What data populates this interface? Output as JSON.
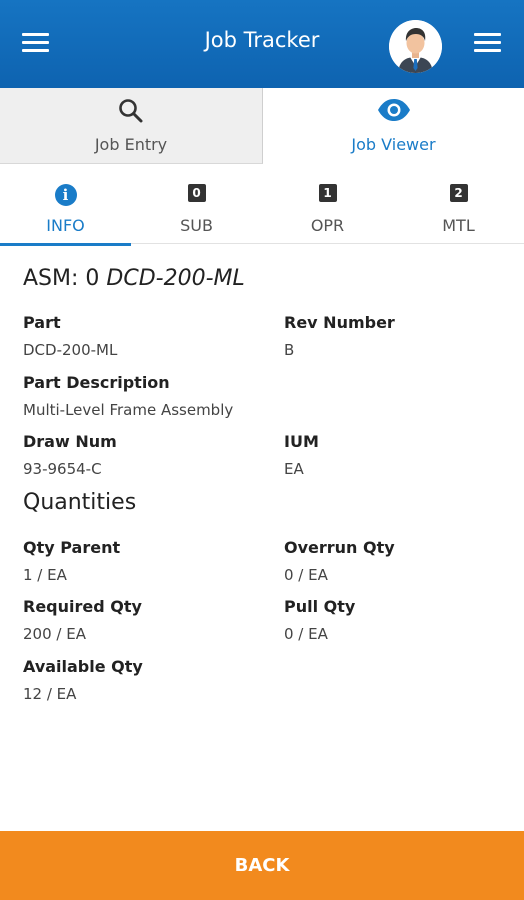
{
  "header": {
    "title": "Job Tracker",
    "menu_icon_left": "hamburger-menu-icon",
    "menu_icon_right": "hamburger-menu-icon",
    "avatar_icon": "user-avatar-icon",
    "colors": {
      "header_bg": "#1674c2",
      "accent": "#1a7cc8",
      "back": "#f28a1e"
    }
  },
  "main_tabs": [
    {
      "label": "Job Entry",
      "icon": "search-icon",
      "active": false
    },
    {
      "label": "Job Viewer",
      "icon": "eye-icon",
      "active": true
    }
  ],
  "sub_tabs": [
    {
      "label": "INFO",
      "icon": "info-icon",
      "badge": "i",
      "active": true
    },
    {
      "label": "SUB",
      "icon": "badge-0-icon",
      "badge": "0",
      "active": false
    },
    {
      "label": "OPR",
      "icon": "badge-1-icon",
      "badge": "1",
      "active": false
    },
    {
      "label": "MTL",
      "icon": "badge-2-icon",
      "badge": "2",
      "active": false
    }
  ],
  "asm": {
    "prefix": "ASM: 0",
    "part": "DCD-200-ML"
  },
  "fields": {
    "part": {
      "label": "Part",
      "value": "DCD-200-ML"
    },
    "rev_number": {
      "label": "Rev Number",
      "value": "B"
    },
    "part_description": {
      "label": "Part Description",
      "value": "Multi-Level Frame Assembly"
    },
    "draw_num": {
      "label": "Draw Num",
      "value": "93-9654-C"
    },
    "ium": {
      "label": "IUM",
      "value": "EA"
    }
  },
  "quantities": {
    "title": "Quantities",
    "qty_parent": {
      "label": "Qty Parent",
      "value": "1 / EA"
    },
    "overrun_qty": {
      "label": "Overrun Qty",
      "value": "0 / EA"
    },
    "required_qty": {
      "label": "Required Qty",
      "value": "200 / EA"
    },
    "pull_qty": {
      "label": "Pull Qty",
      "value": "0 / EA"
    },
    "available_qty": {
      "label": "Available Qty",
      "value": "12 / EA"
    }
  },
  "back_button": {
    "label": "BACK"
  }
}
